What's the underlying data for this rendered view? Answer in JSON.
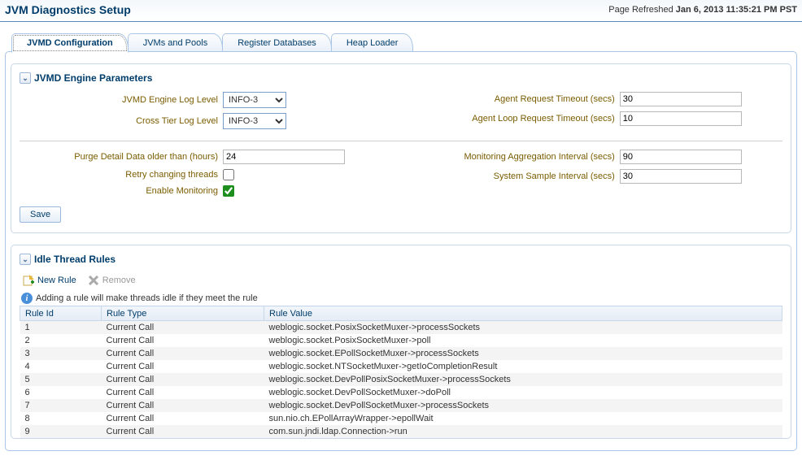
{
  "header": {
    "title": "JVM Diagnostics Setup",
    "refresh_prefix": "Page Refreshed",
    "refresh_value": "Jan 6, 2013 11:35:21 PM PST"
  },
  "tabs": [
    {
      "label": "JVMD Configuration",
      "active": true
    },
    {
      "label": "JVMs and Pools",
      "active": false
    },
    {
      "label": "Register Databases",
      "active": false
    },
    {
      "label": "Heap Loader",
      "active": false
    }
  ],
  "params": {
    "title": "JVMD Engine Parameters",
    "log_level_label": "JVMD Engine Log Level",
    "log_level_value": "INFO-3",
    "cross_tier_label": "Cross Tier Log Level",
    "cross_tier_value": "INFO-3",
    "agent_req_label": "Agent Request Timeout (secs)",
    "agent_req_value": "30",
    "agent_loop_label": "Agent Loop Request Timeout (secs)",
    "agent_loop_value": "10",
    "purge_label": "Purge Detail Data older than (hours)",
    "purge_value": "24",
    "retry_label": "Retry changing threads",
    "retry_checked": false,
    "enable_label": "Enable Monitoring",
    "enable_checked": true,
    "mon_agg_label": "Monitoring Aggregation Interval (secs)",
    "mon_agg_value": "90",
    "sys_sample_label": "System Sample Interval (secs)",
    "sys_sample_value": "30",
    "save_label": "Save"
  },
  "rules": {
    "title": "Idle Thread Rules",
    "new_rule_label": "New Rule",
    "remove_label": "Remove",
    "info_text": "Adding a rule will make threads idle if they meet the rule",
    "columns": {
      "id": "Rule Id",
      "type": "Rule Type",
      "value": "Rule Value"
    },
    "rows": [
      {
        "id": "1",
        "type": "Current Call",
        "value": "weblogic.socket.PosixSocketMuxer->processSockets"
      },
      {
        "id": "2",
        "type": "Current Call",
        "value": "weblogic.socket.PosixSocketMuxer->poll"
      },
      {
        "id": "3",
        "type": "Current Call",
        "value": "weblogic.socket.EPollSocketMuxer->processSockets"
      },
      {
        "id": "4",
        "type": "Current Call",
        "value": "weblogic.socket.NTSocketMuxer->getIoCompletionResult"
      },
      {
        "id": "5",
        "type": "Current Call",
        "value": "weblogic.socket.DevPollPosixSocketMuxer->processSockets"
      },
      {
        "id": "6",
        "type": "Current Call",
        "value": "weblogic.socket.DevPollSocketMuxer->doPoll"
      },
      {
        "id": "7",
        "type": "Current Call",
        "value": "weblogic.socket.DevPollSocketMuxer->processSockets"
      },
      {
        "id": "8",
        "type": "Current Call",
        "value": "sun.nio.ch.EPollArrayWrapper->epollWait"
      },
      {
        "id": "9",
        "type": "Current Call",
        "value": "com.sun.jndi.ldap.Connection->run"
      }
    ]
  }
}
